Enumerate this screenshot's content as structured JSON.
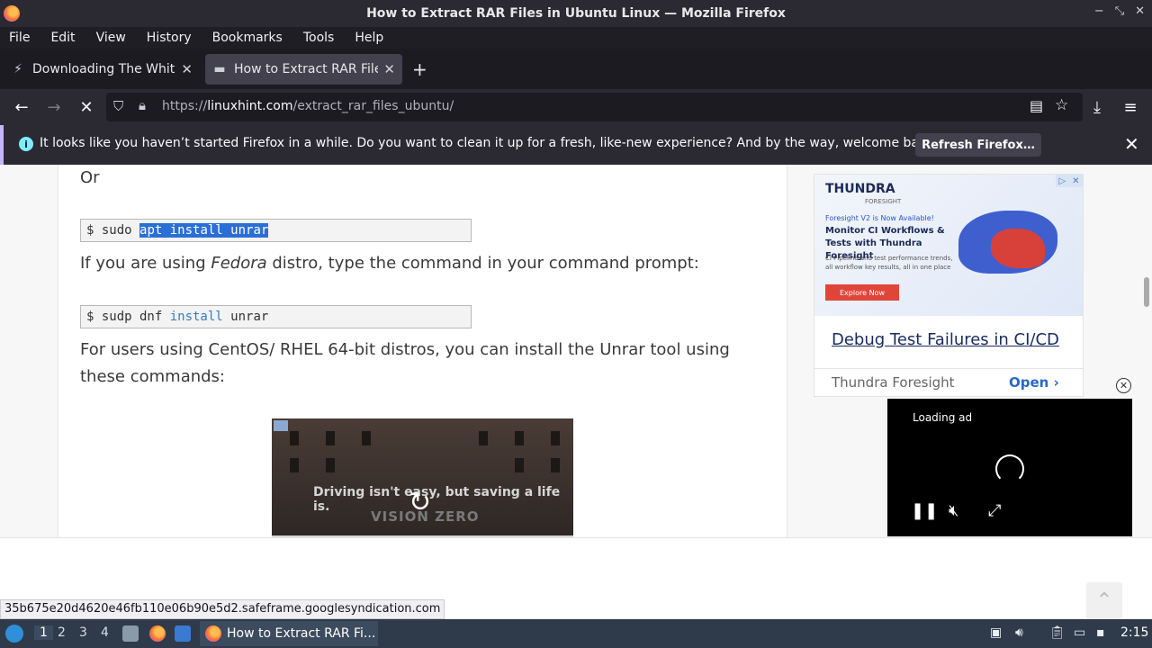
{
  "window": {
    "title": "How to Extract RAR Files in Ubuntu Linux — Mozilla Firefox",
    "controls": [
      "−",
      "⤡",
      "✕"
    ]
  },
  "menu": [
    "File",
    "Edit",
    "View",
    "History",
    "Bookmarks",
    "Tools",
    "Help"
  ],
  "tabs": [
    {
      "label": "Downloading The White L",
      "favicon": "bolt-icon",
      "active": false
    },
    {
      "label": "How to Extract RAR Files",
      "favicon": "linuxhint-icon",
      "active": true
    }
  ],
  "nav": {
    "url_prefix": "https://",
    "url_domain": "linuxhint.com",
    "url_path": "/extract_rar_files_ubuntu/"
  },
  "notification": {
    "message": "It looks like you haven’t started Firefox in a while. Do you want to clean it up for a fresh, like-new experience? And by the way, welcome back!",
    "button": "Refresh Firefox…"
  },
  "article": {
    "or_text": "Or",
    "code1": {
      "prompt": "$ sudo ",
      "selected": "apt install unrar"
    },
    "para_fedora_pre": "If you are using ",
    "para_fedora_em": "Fedora",
    "para_fedora_post": " distro, type the command in your command prompt:",
    "code2": {
      "prompt": "$ sudp dnf ",
      "keyword": "install",
      "rest": " unrar"
    },
    "para_centos_line1": "For users using CentOS/ RHEL 64-bit distros, you can install the Unrar tool using",
    "para_centos_line2": "these commands:",
    "video": {
      "caption": "Driving isn't easy, but saving a life is.",
      "brand": "VISION ZERO"
    }
  },
  "sidebar_ad": {
    "brand": "THUNDRA",
    "brand_sub": "FORESIGHT",
    "small": "Foresight V2 is Now Available!",
    "headline": "Monitor CI Workflows & Tests with Thundra Foresight",
    "desc": "CI Pipeline and test performance trends, all workflow key results, all in one place",
    "cta": "Explore Now",
    "link": "Debug Test Failures in CI/CD",
    "advertiser": "Thundra Foresight",
    "open": "Open"
  },
  "video_ad": {
    "loading": "Loading ad"
  },
  "status_url": "35b675e20d4620e46fb110e06b90e5d2.safeframe.googlesyndication.com",
  "taskbar": {
    "workspaces": [
      "1",
      "2",
      "3",
      "4"
    ],
    "task_label": "How to Extract RAR Fi...",
    "clock": "2:15"
  }
}
